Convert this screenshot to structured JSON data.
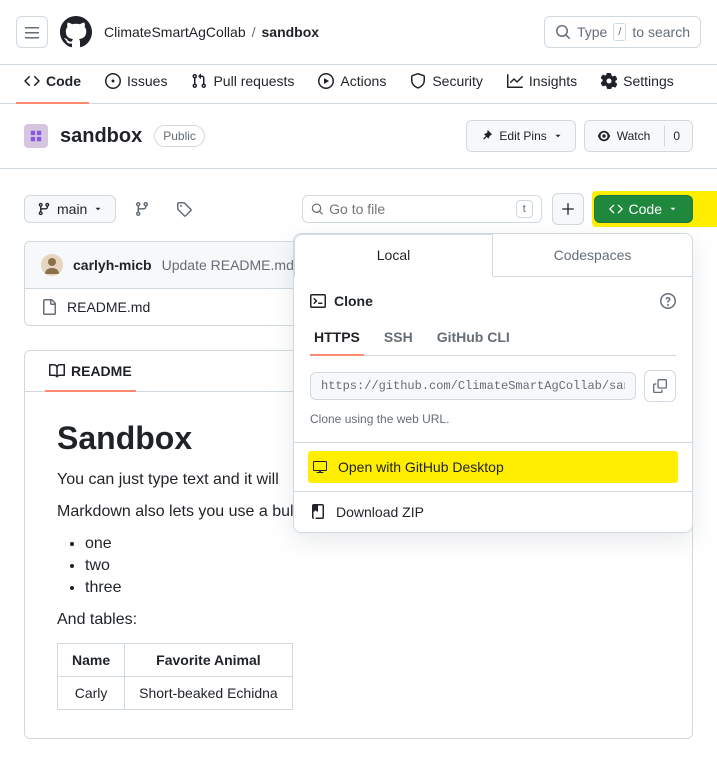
{
  "header": {
    "owner": "ClimateSmartAgCollab",
    "repo": "sandbox",
    "search_text": "Type",
    "search_key": "/",
    "search_suffix": "to search"
  },
  "nav": {
    "code": "Code",
    "issues": "Issues",
    "pulls": "Pull requests",
    "actions": "Actions",
    "security": "Security",
    "insights": "Insights",
    "settings": "Settings"
  },
  "repo": {
    "name": "sandbox",
    "visibility": "Public",
    "edit_pins": "Edit Pins",
    "watch": "Watch",
    "watch_count": "0"
  },
  "toolbar": {
    "branch": "main",
    "file_placeholder": "Go to file",
    "t_key": "t",
    "code_label": "Code"
  },
  "code_dropdown": {
    "tab_local": "Local",
    "tab_codespaces": "Codespaces",
    "clone": "Clone",
    "tabs": {
      "https": "HTTPS",
      "ssh": "SSH",
      "cli": "GitHub CLI"
    },
    "url": "https://github.com/ClimateSmartAgCollab/sandbox",
    "help": "Clone using the web URL.",
    "open_desktop": "Open with GitHub Desktop",
    "download_zip": "Download ZIP"
  },
  "commit": {
    "author": "carlyh-micb",
    "message": "Update README.md"
  },
  "files": {
    "readme": "README.md"
  },
  "readme_tab": "README",
  "readme": {
    "title": "Sandbox",
    "p1": "You can just type text and it will",
    "p2": "Markdown also lets you use a bulleted list:",
    "items": [
      "one",
      "two",
      "three"
    ],
    "p3": "And tables:",
    "table": {
      "headers": [
        "Name",
        "Favorite Animal"
      ],
      "rows": [
        [
          "Carly",
          "Short-beaked Echidna"
        ]
      ]
    }
  }
}
